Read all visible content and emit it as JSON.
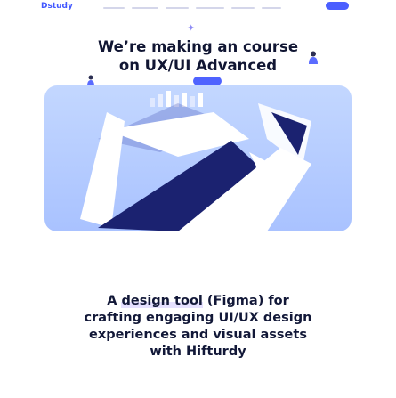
{
  "header": {
    "logo_text": "Dstudy"
  },
  "hero": {
    "headline_line1": "We’re making an course",
    "headline_line2": "on UX/UI Advanced"
  },
  "description": {
    "line1_prefix": "A ",
    "line1_highlight": "design tool",
    "line1_suffix": " (Figma) for",
    "line2": "crafting engaging UI/UX design",
    "line3": "experiences and visual assets",
    "line4": "with Hifturdy"
  },
  "colors": {
    "accent": "#4b5fff",
    "hero_bg": "#aec4ff",
    "text": "#121838"
  }
}
